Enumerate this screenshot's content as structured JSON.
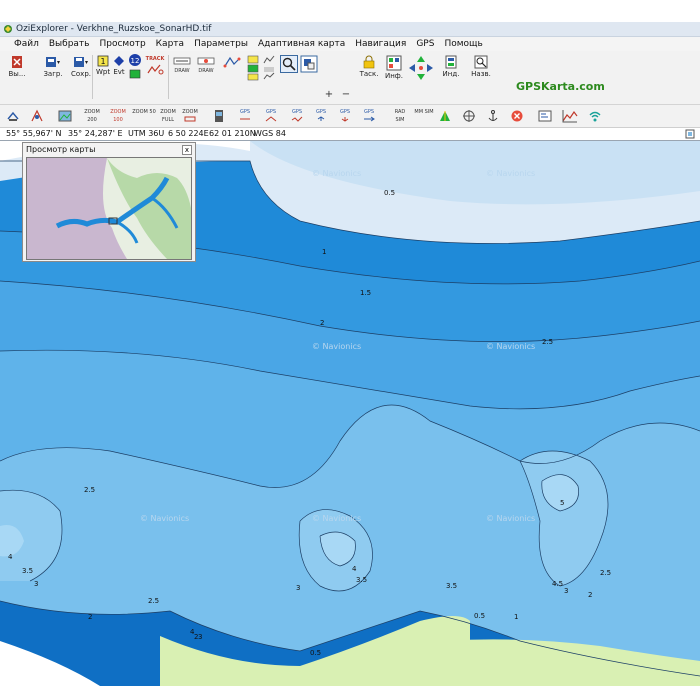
{
  "window": {
    "title": "OziExplorer - Verkhne_Ruzskoe_SonarHD.tif"
  },
  "menu": {
    "items": [
      "Файл",
      "Выбрать",
      "Просмотр",
      "Карта",
      "Параметры",
      "Адаптивная карта",
      "Навигация",
      "GPS",
      "Помощь"
    ]
  },
  "toolbar": {
    "exit_label": "Вы...",
    "load_label": "Загр.",
    "save_label": "Сохр.",
    "wpt_label": "Wpt",
    "evt_label": "Evt",
    "track_label": "TRACK",
    "draw_label": "DRAW",
    "zoom_value": "100",
    "task_label": "Таск.",
    "info_label": "Инф.",
    "ind_label": "Инд.",
    "name_label": "Назв.",
    "brand": "GPSKarta.com"
  },
  "toolbar2": {
    "zoom_labels": [
      "ZOOM 200",
      "ZOOM 100",
      "ZOOM 50",
      "ZOOM FULL",
      "ZOOM"
    ],
    "gps_labels": [
      "GPS",
      "GPS",
      "GPS",
      "GPS",
      "GPS",
      "GPS"
    ],
    "misc_labels": [
      "RAD SIM",
      "MM SIM"
    ]
  },
  "status": {
    "lat": "55° 55,967' N",
    "lon": "35° 24,287' E",
    "grid": "UTM 36U",
    "easting": "6 50 224E",
    "northing": "62 01 210N",
    "datum": "WGS 84"
  },
  "preview": {
    "title": "Просмотр карты",
    "close": "x"
  },
  "map": {
    "watermark": "© Navionics",
    "contour_labels": [
      "0.5",
      "1",
      "1.5",
      "2",
      "2.5",
      "2.5",
      "2.5",
      "2.5",
      "3",
      "3",
      "3",
      "3.5",
      "3.5",
      "3.5",
      "4",
      "4",
      "4",
      "4.5",
      "5",
      "2",
      "2",
      "2",
      "1",
      "0.5",
      "0.5",
      "3"
    ],
    "colors": {
      "shallow": "#dceaf7",
      "deep": "#1f88d6",
      "land": "#d9f0b3",
      "shore": "#3a6e9c"
    }
  }
}
